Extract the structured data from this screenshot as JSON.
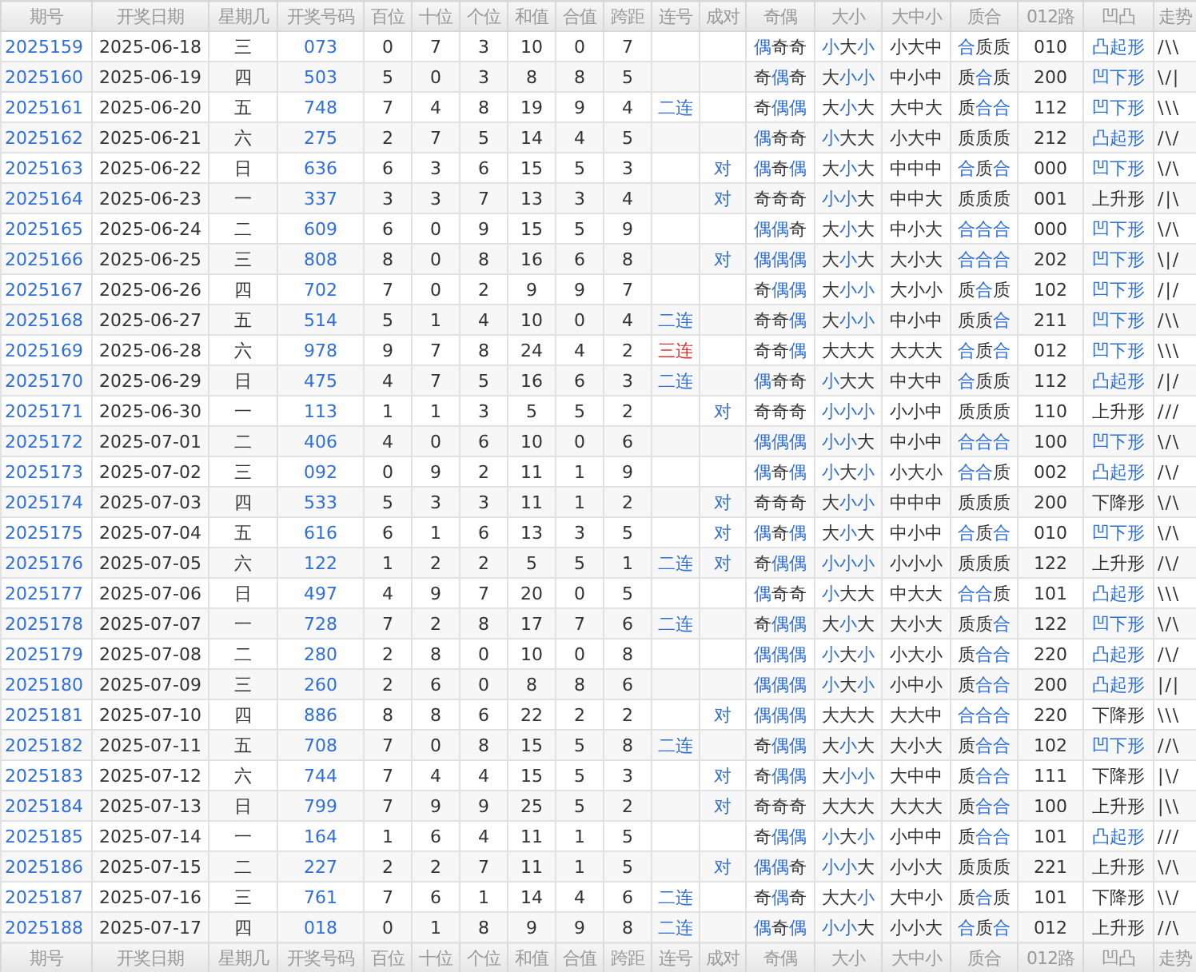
{
  "columns": [
    "期号",
    "开奖日期",
    "星期几",
    "开奖号码",
    "百位",
    "十位",
    "个位",
    "和值",
    "合值",
    "跨距",
    "连号",
    "成对",
    "奇偶",
    "大小",
    "大中小",
    "质合",
    "012路",
    "凹凸",
    "走势"
  ],
  "rows": [
    {
      "issue": "2025159",
      "date": "2025-06-18",
      "weekday": "三",
      "number": "073",
      "hundreds": "0",
      "tens": "7",
      "ones": "3",
      "sum": "10",
      "sum_tail": "0",
      "span": "7",
      "odd_even": "偶奇奇",
      "odd_even_marked": [
        true,
        false,
        false
      ],
      "size": "小大小",
      "size_marked": [
        true,
        false,
        true
      ],
      "zone": "小大中",
      "prime": "合质质",
      "prime_marked": [
        true,
        false,
        false
      ],
      "route": "010",
      "shape": "凸起形",
      "shape_marked": true,
      "trend": "/\\\\"
    },
    {
      "issue": "2025160",
      "date": "2025-06-19",
      "weekday": "四",
      "number": "503",
      "hundreds": "5",
      "tens": "0",
      "ones": "3",
      "sum": "8",
      "sum_tail": "8",
      "span": "5",
      "odd_even": "奇偶奇",
      "odd_even_marked": [
        false,
        true,
        false
      ],
      "size": "大小小",
      "size_marked": [
        false,
        true,
        true
      ],
      "zone": "中小中",
      "prime": "质合质",
      "prime_marked": [
        false,
        true,
        false
      ],
      "route": "200",
      "shape": "凹下形",
      "shape_marked": true,
      "trend": "\\/|"
    },
    {
      "issue": "2025161",
      "date": "2025-06-20",
      "weekday": "五",
      "number": "748",
      "hundreds": "7",
      "tens": "4",
      "ones": "8",
      "sum": "19",
      "sum_tail": "9",
      "span": "4",
      "run": "二连",
      "run_alert": false,
      "odd_even": "奇偶偶",
      "odd_even_marked": [
        false,
        true,
        true
      ],
      "size": "大小大",
      "size_marked": [
        false,
        true,
        false
      ],
      "zone": "大中大",
      "prime": "质合合",
      "prime_marked": [
        false,
        true,
        true
      ],
      "route": "112",
      "shape": "凹下形",
      "shape_marked": true,
      "trend": "\\\\\\"
    },
    {
      "issue": "2025162",
      "date": "2025-06-21",
      "weekday": "六",
      "number": "275",
      "hundreds": "2",
      "tens": "7",
      "ones": "5",
      "sum": "14",
      "sum_tail": "4",
      "span": "5",
      "odd_even": "偶奇奇",
      "odd_even_marked": [
        true,
        false,
        false
      ],
      "size": "小大大",
      "size_marked": [
        true,
        false,
        false
      ],
      "zone": "小大中",
      "prime": "质质质",
      "prime_marked": [
        false,
        false,
        false
      ],
      "route": "212",
      "shape": "凸起形",
      "shape_marked": true,
      "trend": "/\\/"
    },
    {
      "issue": "2025163",
      "date": "2025-06-22",
      "weekday": "日",
      "number": "636",
      "hundreds": "6",
      "tens": "3",
      "ones": "6",
      "sum": "15",
      "sum_tail": "5",
      "span": "3",
      "pair": "对",
      "odd_even": "偶奇偶",
      "odd_even_marked": [
        true,
        false,
        true
      ],
      "size": "大小大",
      "size_marked": [
        false,
        true,
        false
      ],
      "zone": "中中中",
      "prime": "合质合",
      "prime_marked": [
        true,
        false,
        true
      ],
      "route": "000",
      "shape": "凹下形",
      "shape_marked": true,
      "trend": "\\/\\"
    },
    {
      "issue": "2025164",
      "date": "2025-06-23",
      "weekday": "一",
      "number": "337",
      "hundreds": "3",
      "tens": "3",
      "ones": "7",
      "sum": "13",
      "sum_tail": "3",
      "span": "4",
      "pair": "对",
      "odd_even": "奇奇奇",
      "odd_even_marked": [
        false,
        false,
        false
      ],
      "size": "小小大",
      "size_marked": [
        true,
        true,
        false
      ],
      "zone": "中中大",
      "prime": "质质质",
      "prime_marked": [
        false,
        false,
        false
      ],
      "route": "001",
      "shape": "上升形",
      "shape_marked": false,
      "trend": "/|\\"
    },
    {
      "issue": "2025165",
      "date": "2025-06-24",
      "weekday": "二",
      "number": "609",
      "hundreds": "6",
      "tens": "0",
      "ones": "9",
      "sum": "15",
      "sum_tail": "5",
      "span": "9",
      "odd_even": "偶偶奇",
      "odd_even_marked": [
        true,
        true,
        false
      ],
      "size": "大小大",
      "size_marked": [
        false,
        true,
        false
      ],
      "zone": "中小大",
      "prime": "合合合",
      "prime_marked": [
        true,
        true,
        true
      ],
      "route": "000",
      "shape": "凹下形",
      "shape_marked": true,
      "trend": "\\/\\"
    },
    {
      "issue": "2025166",
      "date": "2025-06-25",
      "weekday": "三",
      "number": "808",
      "hundreds": "8",
      "tens": "0",
      "ones": "8",
      "sum": "16",
      "sum_tail": "6",
      "span": "8",
      "pair": "对",
      "odd_even": "偶偶偶",
      "odd_even_marked": [
        true,
        true,
        true
      ],
      "size": "大小大",
      "size_marked": [
        false,
        true,
        false
      ],
      "zone": "大小大",
      "prime": "合合合",
      "prime_marked": [
        true,
        true,
        true
      ],
      "route": "202",
      "shape": "凹下形",
      "shape_marked": true,
      "trend": "\\|/"
    },
    {
      "issue": "2025167",
      "date": "2025-06-26",
      "weekday": "四",
      "number": "702",
      "hundreds": "7",
      "tens": "0",
      "ones": "2",
      "sum": "9",
      "sum_tail": "9",
      "span": "7",
      "odd_even": "奇偶偶",
      "odd_even_marked": [
        false,
        true,
        true
      ],
      "size": "大小小",
      "size_marked": [
        false,
        true,
        true
      ],
      "zone": "大小小",
      "prime": "质合质",
      "prime_marked": [
        false,
        true,
        false
      ],
      "route": "102",
      "shape": "凹下形",
      "shape_marked": true,
      "trend": "/|/"
    },
    {
      "issue": "2025168",
      "date": "2025-06-27",
      "weekday": "五",
      "number": "514",
      "hundreds": "5",
      "tens": "1",
      "ones": "4",
      "sum": "10",
      "sum_tail": "0",
      "span": "4",
      "run": "二连",
      "run_alert": false,
      "odd_even": "奇奇偶",
      "odd_even_marked": [
        false,
        false,
        true
      ],
      "size": "大小小",
      "size_marked": [
        false,
        true,
        true
      ],
      "zone": "中小中",
      "prime": "质质合",
      "prime_marked": [
        false,
        false,
        true
      ],
      "route": "211",
      "shape": "凹下形",
      "shape_marked": true,
      "trend": "/\\\\"
    },
    {
      "issue": "2025169",
      "date": "2025-06-28",
      "weekday": "六",
      "number": "978",
      "hundreds": "9",
      "tens": "7",
      "ones": "8",
      "sum": "24",
      "sum_tail": "4",
      "span": "2",
      "run": "三连",
      "run_alert": true,
      "odd_even": "奇奇偶",
      "odd_even_marked": [
        false,
        false,
        true
      ],
      "size": "大大大",
      "size_marked": [
        false,
        false,
        false
      ],
      "zone": "大大大",
      "prime": "合质合",
      "prime_marked": [
        true,
        false,
        true
      ],
      "route": "012",
      "shape": "凹下形",
      "shape_marked": true,
      "trend": "\\\\\\"
    },
    {
      "issue": "2025170",
      "date": "2025-06-29",
      "weekday": "日",
      "number": "475",
      "hundreds": "4",
      "tens": "7",
      "ones": "5",
      "sum": "16",
      "sum_tail": "6",
      "span": "3",
      "run": "二连",
      "run_alert": false,
      "odd_even": "偶奇奇",
      "odd_even_marked": [
        true,
        false,
        false
      ],
      "size": "小大大",
      "size_marked": [
        true,
        false,
        false
      ],
      "zone": "中大中",
      "prime": "合质质",
      "prime_marked": [
        true,
        false,
        false
      ],
      "route": "112",
      "shape": "凸起形",
      "shape_marked": true,
      "trend": "/|/"
    },
    {
      "issue": "2025171",
      "date": "2025-06-30",
      "weekday": "一",
      "number": "113",
      "hundreds": "1",
      "tens": "1",
      "ones": "3",
      "sum": "5",
      "sum_tail": "5",
      "span": "2",
      "pair": "对",
      "odd_even": "奇奇奇",
      "odd_even_marked": [
        false,
        false,
        false
      ],
      "size": "小小小",
      "size_marked": [
        true,
        true,
        true
      ],
      "zone": "小小中",
      "prime": "质质质",
      "prime_marked": [
        false,
        false,
        false
      ],
      "route": "110",
      "shape": "上升形",
      "shape_marked": false,
      "trend": "///"
    },
    {
      "issue": "2025172",
      "date": "2025-07-01",
      "weekday": "二",
      "number": "406",
      "hundreds": "4",
      "tens": "0",
      "ones": "6",
      "sum": "10",
      "sum_tail": "0",
      "span": "6",
      "odd_even": "偶偶偶",
      "odd_even_marked": [
        true,
        true,
        true
      ],
      "size": "小小大",
      "size_marked": [
        true,
        true,
        false
      ],
      "zone": "中小中",
      "prime": "合合合",
      "prime_marked": [
        true,
        true,
        true
      ],
      "route": "100",
      "shape": "凹下形",
      "shape_marked": true,
      "trend": "\\/\\"
    },
    {
      "issue": "2025173",
      "date": "2025-07-02",
      "weekday": "三",
      "number": "092",
      "hundreds": "0",
      "tens": "9",
      "ones": "2",
      "sum": "11",
      "sum_tail": "1",
      "span": "9",
      "odd_even": "偶奇偶",
      "odd_even_marked": [
        true,
        false,
        true
      ],
      "size": "小大小",
      "size_marked": [
        true,
        false,
        true
      ],
      "zone": "小大小",
      "prime": "合合质",
      "prime_marked": [
        true,
        true,
        false
      ],
      "route": "002",
      "shape": "凸起形",
      "shape_marked": true,
      "trend": "/\\/"
    },
    {
      "issue": "2025174",
      "date": "2025-07-03",
      "weekday": "四",
      "number": "533",
      "hundreds": "5",
      "tens": "3",
      "ones": "3",
      "sum": "11",
      "sum_tail": "1",
      "span": "2",
      "pair": "对",
      "odd_even": "奇奇奇",
      "odd_even_marked": [
        false,
        false,
        false
      ],
      "size": "大小小",
      "size_marked": [
        false,
        true,
        true
      ],
      "zone": "中中中",
      "prime": "质质质",
      "prime_marked": [
        false,
        false,
        false
      ],
      "route": "200",
      "shape": "下降形",
      "shape_marked": false,
      "trend": "\\/\\"
    },
    {
      "issue": "2025175",
      "date": "2025-07-04",
      "weekday": "五",
      "number": "616",
      "hundreds": "6",
      "tens": "1",
      "ones": "6",
      "sum": "13",
      "sum_tail": "3",
      "span": "5",
      "pair": "对",
      "odd_even": "偶奇偶",
      "odd_even_marked": [
        true,
        false,
        true
      ],
      "size": "大小大",
      "size_marked": [
        false,
        true,
        false
      ],
      "zone": "中小中",
      "prime": "合质合",
      "prime_marked": [
        true,
        false,
        true
      ],
      "route": "010",
      "shape": "凹下形",
      "shape_marked": true,
      "trend": "\\/\\"
    },
    {
      "issue": "2025176",
      "date": "2025-07-05",
      "weekday": "六",
      "number": "122",
      "hundreds": "1",
      "tens": "2",
      "ones": "2",
      "sum": "5",
      "sum_tail": "5",
      "span": "1",
      "run": "二连",
      "run_alert": false,
      "pair": "对",
      "odd_even": "奇偶偶",
      "odd_even_marked": [
        false,
        true,
        true
      ],
      "size": "小小小",
      "size_marked": [
        true,
        true,
        true
      ],
      "zone": "小小小",
      "prime": "质质质",
      "prime_marked": [
        false,
        false,
        false
      ],
      "route": "122",
      "shape": "上升形",
      "shape_marked": false,
      "trend": "/\\/"
    },
    {
      "issue": "2025177",
      "date": "2025-07-06",
      "weekday": "日",
      "number": "497",
      "hundreds": "4",
      "tens": "9",
      "ones": "7",
      "sum": "20",
      "sum_tail": "0",
      "span": "5",
      "odd_even": "偶奇奇",
      "odd_even_marked": [
        true,
        false,
        false
      ],
      "size": "小大大",
      "size_marked": [
        true,
        false,
        false
      ],
      "zone": "中大大",
      "prime": "合合质",
      "prime_marked": [
        true,
        true,
        false
      ],
      "route": "101",
      "shape": "凸起形",
      "shape_marked": true,
      "trend": "\\\\\\"
    },
    {
      "issue": "2025178",
      "date": "2025-07-07",
      "weekday": "一",
      "number": "728",
      "hundreds": "7",
      "tens": "2",
      "ones": "8",
      "sum": "17",
      "sum_tail": "7",
      "span": "6",
      "run": "二连",
      "run_alert": false,
      "odd_even": "奇偶偶",
      "odd_even_marked": [
        false,
        true,
        true
      ],
      "size": "大小大",
      "size_marked": [
        false,
        true,
        false
      ],
      "zone": "大小大",
      "prime": "质质合",
      "prime_marked": [
        false,
        false,
        true
      ],
      "route": "122",
      "shape": "凹下形",
      "shape_marked": true,
      "trend": "\\/\\"
    },
    {
      "issue": "2025179",
      "date": "2025-07-08",
      "weekday": "二",
      "number": "280",
      "hundreds": "2",
      "tens": "8",
      "ones": "0",
      "sum": "10",
      "sum_tail": "0",
      "span": "8",
      "odd_even": "偶偶偶",
      "odd_even_marked": [
        true,
        true,
        true
      ],
      "size": "小大小",
      "size_marked": [
        true,
        false,
        true
      ],
      "zone": "小大小",
      "prime": "质合合",
      "prime_marked": [
        false,
        true,
        true
      ],
      "route": "220",
      "shape": "凸起形",
      "shape_marked": true,
      "trend": "/\\/"
    },
    {
      "issue": "2025180",
      "date": "2025-07-09",
      "weekday": "三",
      "number": "260",
      "hundreds": "2",
      "tens": "6",
      "ones": "0",
      "sum": "8",
      "sum_tail": "8",
      "span": "6",
      "odd_even": "偶偶偶",
      "odd_even_marked": [
        true,
        true,
        true
      ],
      "size": "小大小",
      "size_marked": [
        true,
        false,
        true
      ],
      "zone": "小中小",
      "prime": "质合合",
      "prime_marked": [
        false,
        true,
        true
      ],
      "route": "200",
      "shape": "凸起形",
      "shape_marked": true,
      "trend": "|/|"
    },
    {
      "issue": "2025181",
      "date": "2025-07-10",
      "weekday": "四",
      "number": "886",
      "hundreds": "8",
      "tens": "8",
      "ones": "6",
      "sum": "22",
      "sum_tail": "2",
      "span": "2",
      "pair": "对",
      "odd_even": "偶偶偶",
      "odd_even_marked": [
        true,
        true,
        true
      ],
      "size": "大大大",
      "size_marked": [
        false,
        false,
        false
      ],
      "zone": "大大中",
      "prime": "合合合",
      "prime_marked": [
        true,
        true,
        true
      ],
      "route": "220",
      "shape": "下降形",
      "shape_marked": false,
      "trend": "\\\\\\"
    },
    {
      "issue": "2025182",
      "date": "2025-07-11",
      "weekday": "五",
      "number": "708",
      "hundreds": "7",
      "tens": "0",
      "ones": "8",
      "sum": "15",
      "sum_tail": "5",
      "span": "8",
      "run": "二连",
      "run_alert": false,
      "odd_even": "奇偶偶",
      "odd_even_marked": [
        false,
        true,
        true
      ],
      "size": "大小大",
      "size_marked": [
        false,
        true,
        false
      ],
      "zone": "大小大",
      "prime": "质合合",
      "prime_marked": [
        false,
        true,
        true
      ],
      "route": "102",
      "shape": "凹下形",
      "shape_marked": true,
      "trend": "//\\"
    },
    {
      "issue": "2025183",
      "date": "2025-07-12",
      "weekday": "六",
      "number": "744",
      "hundreds": "7",
      "tens": "4",
      "ones": "4",
      "sum": "15",
      "sum_tail": "5",
      "span": "3",
      "pair": "对",
      "odd_even": "奇偶偶",
      "odd_even_marked": [
        false,
        true,
        true
      ],
      "size": "大小小",
      "size_marked": [
        false,
        true,
        true
      ],
      "zone": "大中中",
      "prime": "质合合",
      "prime_marked": [
        false,
        true,
        true
      ],
      "route": "111",
      "shape": "下降形",
      "shape_marked": false,
      "trend": "|\\/"
    },
    {
      "issue": "2025184",
      "date": "2025-07-13",
      "weekday": "日",
      "number": "799",
      "hundreds": "7",
      "tens": "9",
      "ones": "9",
      "sum": "25",
      "sum_tail": "5",
      "span": "2",
      "pair": "对",
      "odd_even": "奇奇奇",
      "odd_even_marked": [
        false,
        false,
        false
      ],
      "size": "大大大",
      "size_marked": [
        false,
        false,
        false
      ],
      "zone": "大大大",
      "prime": "质合合",
      "prime_marked": [
        false,
        true,
        true
      ],
      "route": "100",
      "shape": "上升形",
      "shape_marked": false,
      "trend": "|\\\\"
    },
    {
      "issue": "2025185",
      "date": "2025-07-14",
      "weekday": "一",
      "number": "164",
      "hundreds": "1",
      "tens": "6",
      "ones": "4",
      "sum": "11",
      "sum_tail": "1",
      "span": "5",
      "odd_even": "奇偶偶",
      "odd_even_marked": [
        false,
        true,
        true
      ],
      "size": "小大小",
      "size_marked": [
        true,
        false,
        true
      ],
      "zone": "小中中",
      "prime": "质合合",
      "prime_marked": [
        false,
        true,
        true
      ],
      "route": "101",
      "shape": "凸起形",
      "shape_marked": true,
      "trend": "///"
    },
    {
      "issue": "2025186",
      "date": "2025-07-15",
      "weekday": "二",
      "number": "227",
      "hundreds": "2",
      "tens": "2",
      "ones": "7",
      "sum": "11",
      "sum_tail": "1",
      "span": "5",
      "pair": "对",
      "odd_even": "偶偶奇",
      "odd_even_marked": [
        true,
        true,
        false
      ],
      "size": "小小大",
      "size_marked": [
        true,
        true,
        false
      ],
      "zone": "小小大",
      "prime": "质质质",
      "prime_marked": [
        false,
        false,
        false
      ],
      "route": "221",
      "shape": "上升形",
      "shape_marked": false,
      "trend": "\\/\\"
    },
    {
      "issue": "2025187",
      "date": "2025-07-16",
      "weekday": "三",
      "number": "761",
      "hundreds": "7",
      "tens": "6",
      "ones": "1",
      "sum": "14",
      "sum_tail": "4",
      "span": "6",
      "run": "二连",
      "run_alert": false,
      "odd_even": "奇偶奇",
      "odd_even_marked": [
        false,
        true,
        false
      ],
      "size": "大大小",
      "size_marked": [
        false,
        false,
        true
      ],
      "zone": "大中小",
      "prime": "质合质",
      "prime_marked": [
        false,
        true,
        false
      ],
      "route": "101",
      "shape": "下降形",
      "shape_marked": false,
      "trend": "\\\\/"
    },
    {
      "issue": "2025188",
      "date": "2025-07-17",
      "weekday": "四",
      "number": "018",
      "hundreds": "0",
      "tens": "1",
      "ones": "8",
      "sum": "9",
      "sum_tail": "9",
      "span": "8",
      "run": "二连",
      "run_alert": false,
      "odd_even": "偶奇偶",
      "odd_even_marked": [
        true,
        false,
        true
      ],
      "size": "小小大",
      "size_marked": [
        true,
        true,
        false
      ],
      "zone": "小小大",
      "prime": "合质合",
      "prime_marked": [
        true,
        false,
        true
      ],
      "route": "012",
      "shape": "上升形",
      "shape_marked": false,
      "trend": "//\\"
    }
  ],
  "footer_columns": [
    "期号",
    "开奖日期",
    "星期几",
    "开奖号码",
    "百位",
    "十位",
    "个位",
    "和值",
    "合值",
    "跨距",
    "连号",
    "成对",
    "奇偶",
    "大小",
    "大中小",
    "质合",
    "012路",
    "凹凸",
    "走势"
  ]
}
